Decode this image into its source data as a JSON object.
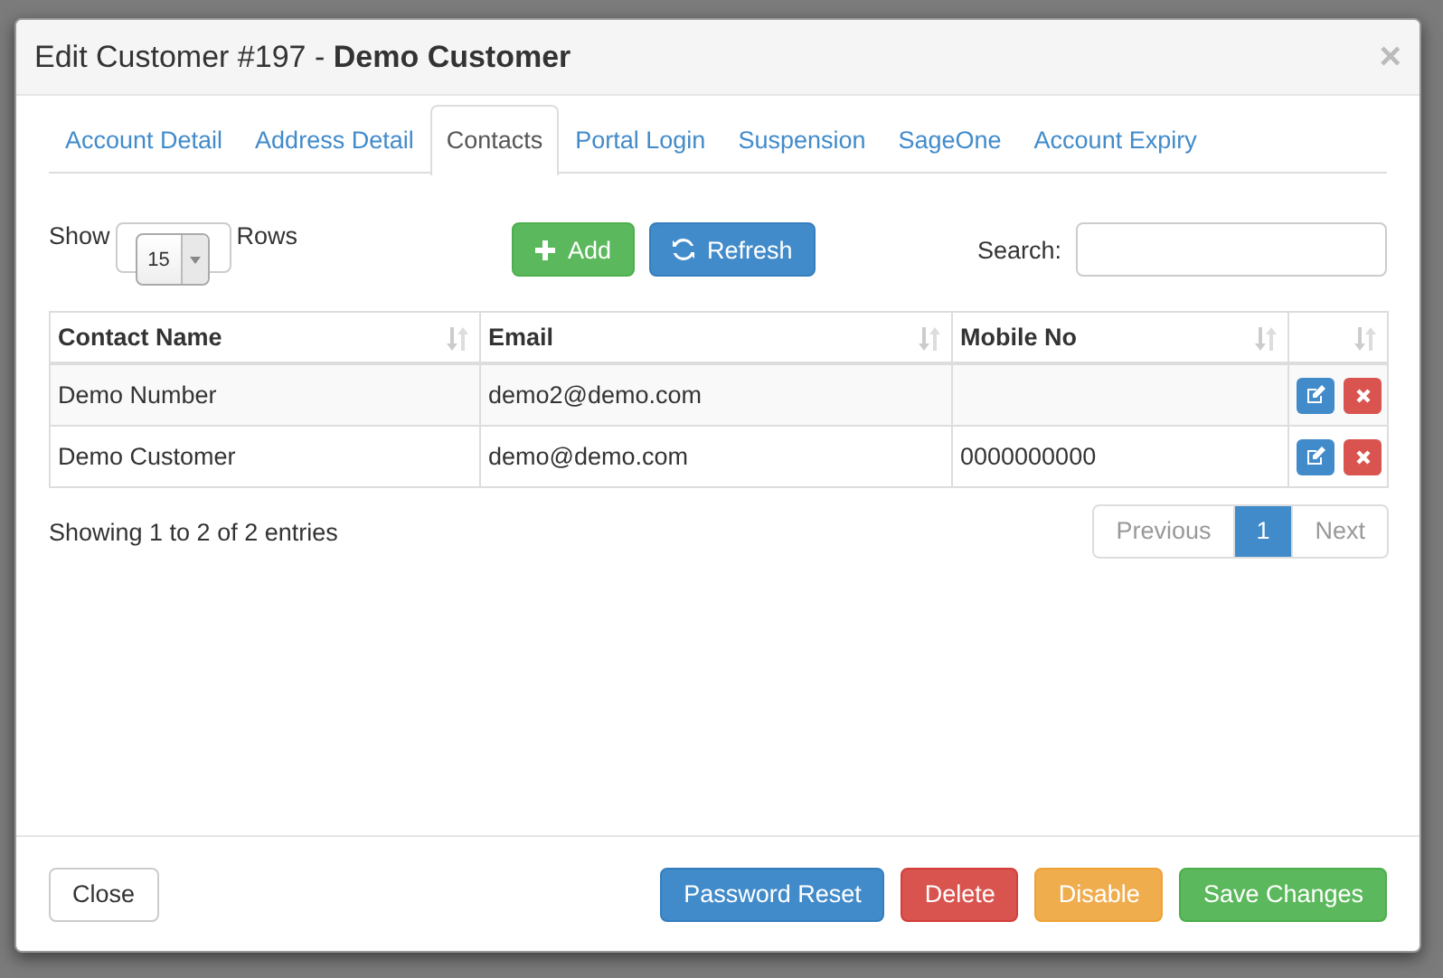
{
  "modal": {
    "title_prefix": "Edit Customer #197 - ",
    "title_name": "Demo Customer",
    "close": "×"
  },
  "tabs": [
    {
      "label": "Account Detail",
      "selected": false
    },
    {
      "label": "Address Detail",
      "selected": false
    },
    {
      "label": "Contacts",
      "selected": true
    },
    {
      "label": "Portal Login",
      "selected": false
    },
    {
      "label": "Suspension",
      "selected": false
    },
    {
      "label": "SageOne",
      "selected": false
    },
    {
      "label": "Account Expiry",
      "selected": false
    }
  ],
  "length_menu": {
    "before": "Show",
    "value": "15",
    "after": "Rows"
  },
  "toolbar": [
    {
      "label": "Add",
      "kind": "success"
    },
    {
      "label": "Refresh",
      "kind": "primary"
    }
  ],
  "search": {
    "label": "Search:"
  },
  "table": {
    "columns": [
      "Contact Name",
      "Email",
      "Mobile No"
    ],
    "rows": [
      {
        "cells": [
          "Demo Number",
          "demo2@demo.com"
        ]
      },
      {
        "cells": [
          "Demo Customer",
          "demo@demo.com",
          "0000000000"
        ]
      }
    ]
  },
  "info": "Showing 1 to 2 of 2 entries",
  "pagination": [
    {
      "label": "Previous",
      "selected": false,
      "disabled": true
    },
    {
      "label": "1",
      "selected": true,
      "disabled": false
    },
    {
      "label": "Next",
      "selected": false,
      "disabled": true
    }
  ],
  "footer_buttons": [
    {
      "label": "Close",
      "kind": "default"
    },
    {
      "label": "Password Reset",
      "kind": "primary"
    },
    {
      "label": "Delete",
      "kind": "danger"
    },
    {
      "label": "Disable",
      "kind": "warning"
    },
    {
      "label": "Save Changes",
      "kind": "success"
    }
  ]
}
